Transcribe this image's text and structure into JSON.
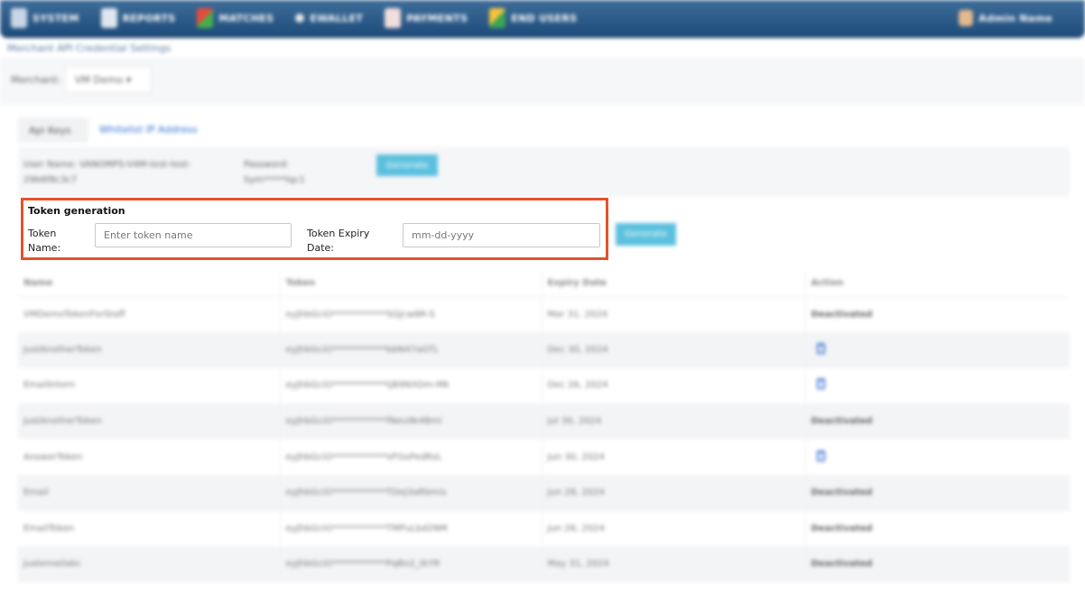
{
  "nav": {
    "items": [
      {
        "label": "SYSTEM",
        "icon": "system-icon"
      },
      {
        "label": "REPORTS",
        "icon": "reports-icon"
      },
      {
        "label": "MATCHES",
        "icon": "matches-icon"
      },
      {
        "label": "EWALLET",
        "icon": "ewallet-icon"
      },
      {
        "label": "PAYMENTS",
        "icon": "payments-icon"
      },
      {
        "label": "END USERS",
        "icon": "end-users-icon"
      }
    ],
    "user": "Admin Name"
  },
  "page": {
    "title": "Merchant API Credential Settings",
    "merchant_label": "Merchant:",
    "merchant_value": "VM Demo"
  },
  "tabs": {
    "api_keys": "Api Keys",
    "whitelist": "Whitelist IP Address"
  },
  "credentials": {
    "username_line1": "User Name: VANOMPS-V4M-test-test-",
    "username_line2": "29b6f8c3c7",
    "password_label": "Password:",
    "password_value": "Sym*****lqc1",
    "button_label": "Generate"
  },
  "token_generation": {
    "heading": "Token generation",
    "name_label": "Token Name:",
    "name_placeholder": "Enter token name",
    "expiry_label": "Token Expiry Date:",
    "expiry_placeholder": "mm-dd-yyyy",
    "generate_label": "Generate"
  },
  "table": {
    "headers": [
      "Name",
      "Token",
      "Expiry Date",
      "Action"
    ],
    "rows": [
      {
        "name": "VMDemoTokenForStaff",
        "token": "eyJhbGciO************SGJcw8R-S",
        "expiry": "Mar 31, 2024",
        "action": "Deactivated"
      },
      {
        "name": "JustAnotherToken",
        "token": "eyJhbGciO************bbN47aGTL",
        "expiry": "Dec 30, 2024",
        "action": ""
      },
      {
        "name": "EmailIntern",
        "token": "eyJhbGciO************tjB9NXDm-Mk",
        "expiry": "Dec 26, 2024",
        "action": ""
      },
      {
        "name": "JustAnotherToken",
        "token": "eyJhbGciO************fNeu9k4Bmi",
        "expiry": "Jul 30, 2024",
        "action": "Deactivated"
      },
      {
        "name": "AnswerToken",
        "token": "eyJhbGciO************VFGsPedRsL",
        "expiry": "Jun 30, 2024",
        "action": ""
      },
      {
        "name": "Email",
        "token": "eyJhbGciO************TDeJ3aRbmis",
        "expiry": "Jun 28, 2024",
        "action": "Deactivated"
      },
      {
        "name": "EmailToken",
        "token": "eyJhbGciO************TMPuLbd2NM",
        "expiry": "Jun 26, 2024",
        "action": "Deactivated"
      },
      {
        "name": "Justemailabc",
        "token": "eyJhbGciO************PqBo2_tkYR",
        "expiry": "May 31, 2024",
        "action": "Deactivated"
      }
    ]
  }
}
